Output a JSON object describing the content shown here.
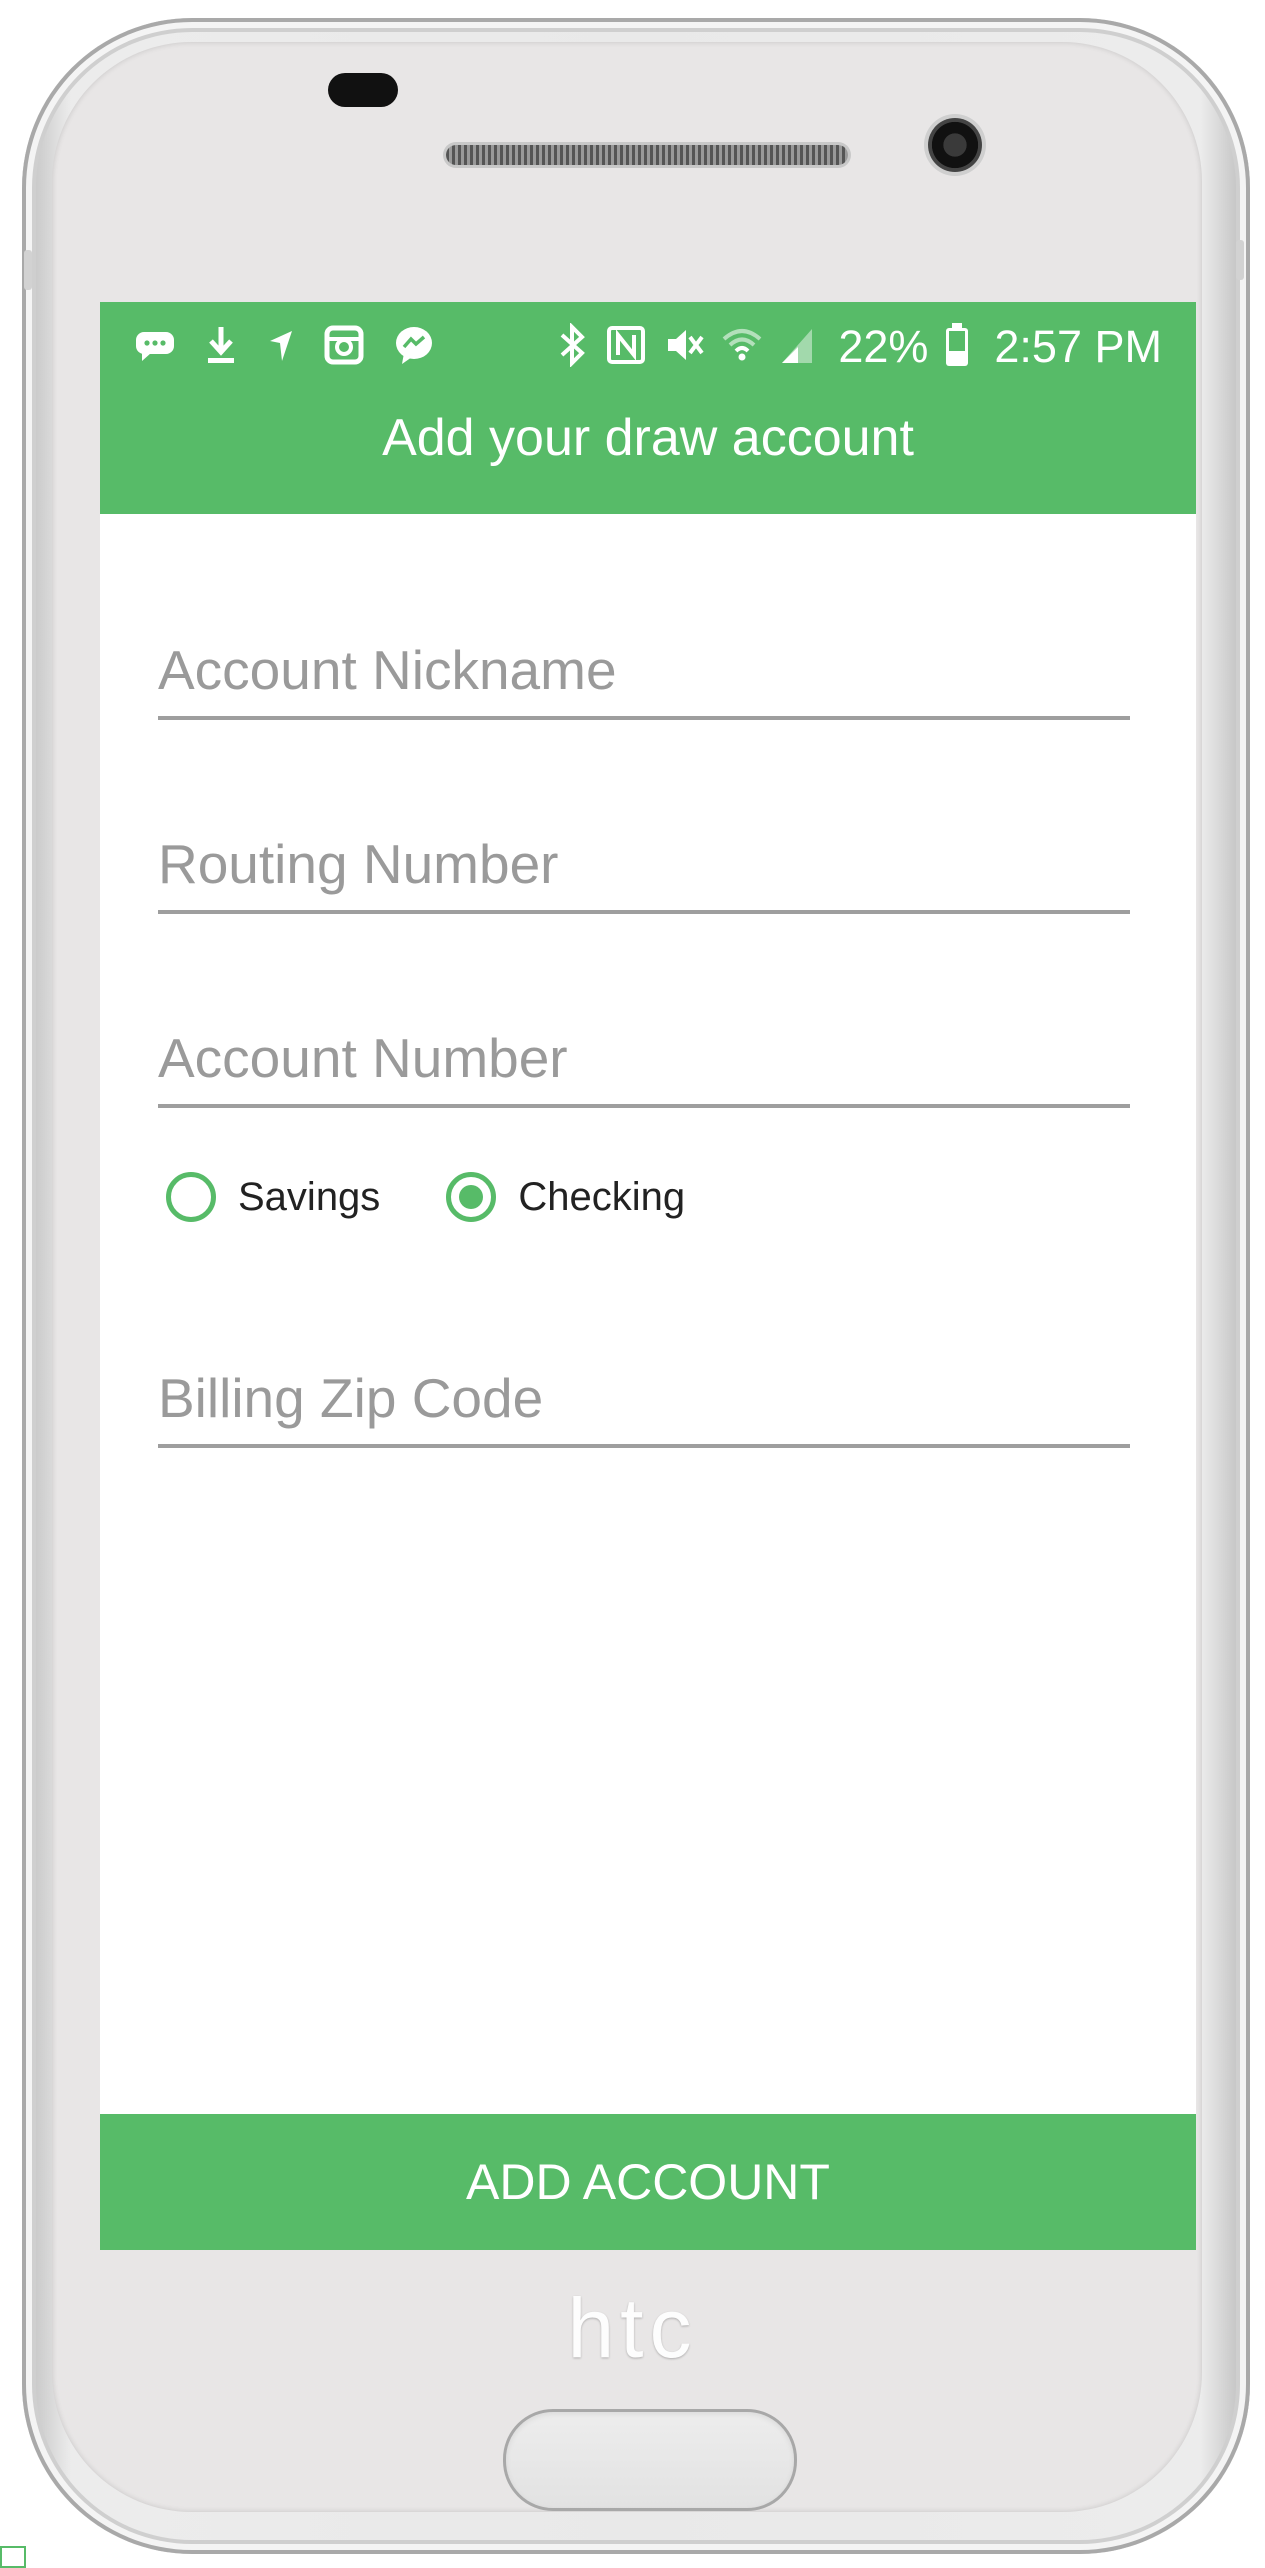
{
  "device": {
    "brand_logo": "htc"
  },
  "status_bar": {
    "notification_icons": [
      "message-icon",
      "download-icon",
      "location-icon",
      "instagram-icon",
      "messenger-icon"
    ],
    "system_icons": [
      "bluetooth-icon",
      "nfc-icon",
      "mute-icon",
      "wifi-icon",
      "signal-icon"
    ],
    "battery_percent": "22%",
    "time": "2:57 PM"
  },
  "app_bar": {
    "title": "Add your draw account"
  },
  "form": {
    "account_nickname": {
      "placeholder": "Account Nickname",
      "value": ""
    },
    "routing_number": {
      "placeholder": "Routing Number",
      "value": ""
    },
    "account_number": {
      "placeholder": "Account Number",
      "value": ""
    },
    "account_type": {
      "options": [
        "Savings",
        "Checking"
      ],
      "selected": "Checking"
    },
    "billing_zip": {
      "placeholder": "Billing Zip Code",
      "value": ""
    }
  },
  "actions": {
    "add_account_label": "ADD ACCOUNT"
  },
  "colors": {
    "accent": "#57bb68",
    "field_underline": "#9e9e9e",
    "placeholder": "#9a9a9a"
  }
}
